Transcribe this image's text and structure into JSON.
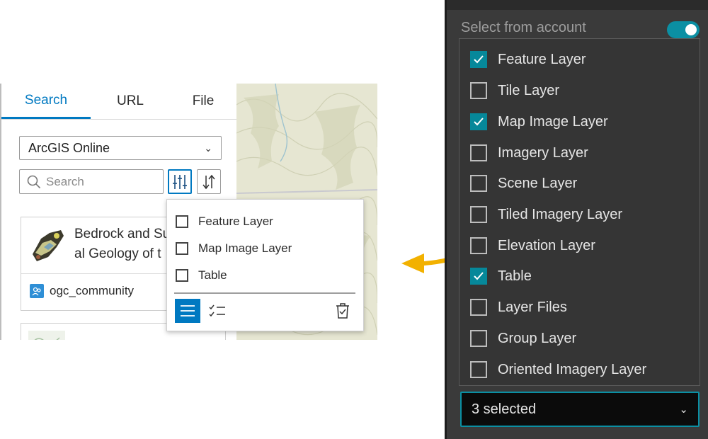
{
  "tabs": [
    {
      "label": "Search",
      "active": true
    },
    {
      "label": "URL",
      "active": false
    },
    {
      "label": "File",
      "active": false
    }
  ],
  "source_select": {
    "value": "ArcGIS Online",
    "chevron_icon": "chevron-down-icon"
  },
  "search": {
    "placeholder": "Search",
    "icon": "search-icon"
  },
  "toolbar": {
    "filter_icon": "filter-sliders-icon",
    "sort_icon": "sort-icon"
  },
  "results": [
    {
      "title_line1": "Bedrock and Su",
      "title_line2": "al Geology of t",
      "owner": "ogc_community"
    }
  ],
  "filter_popover": {
    "items": [
      {
        "label": "Feature Layer",
        "checked": false
      },
      {
        "label": "Map Image Layer",
        "checked": false
      },
      {
        "label": "Table",
        "checked": false
      }
    ],
    "tools": [
      "list-icon",
      "checklist-icon",
      "trash-check-icon"
    ]
  },
  "account_panel": {
    "label": "Select from account",
    "toggle_on": true,
    "items": [
      {
        "label": "Feature Layer",
        "checked": true
      },
      {
        "label": "Tile Layer",
        "checked": false
      },
      {
        "label": "Map Image Layer",
        "checked": true
      },
      {
        "label": "Imagery Layer",
        "checked": false
      },
      {
        "label": "Scene Layer",
        "checked": false
      },
      {
        "label": "Tiled Imagery Layer",
        "checked": false
      },
      {
        "label": "Elevation Layer",
        "checked": false
      },
      {
        "label": "Table",
        "checked": true
      },
      {
        "label": "Layer Files",
        "checked": false
      },
      {
        "label": "Group Layer",
        "checked": false
      },
      {
        "label": "Oriented Imagery Layer",
        "checked": false
      }
    ],
    "select_value": "3 selected"
  },
  "colors": {
    "accent_blue": "#0079c1",
    "teal": "#06889a",
    "dark_bg": "#3a3a3a",
    "arrow": "#f2b100"
  }
}
